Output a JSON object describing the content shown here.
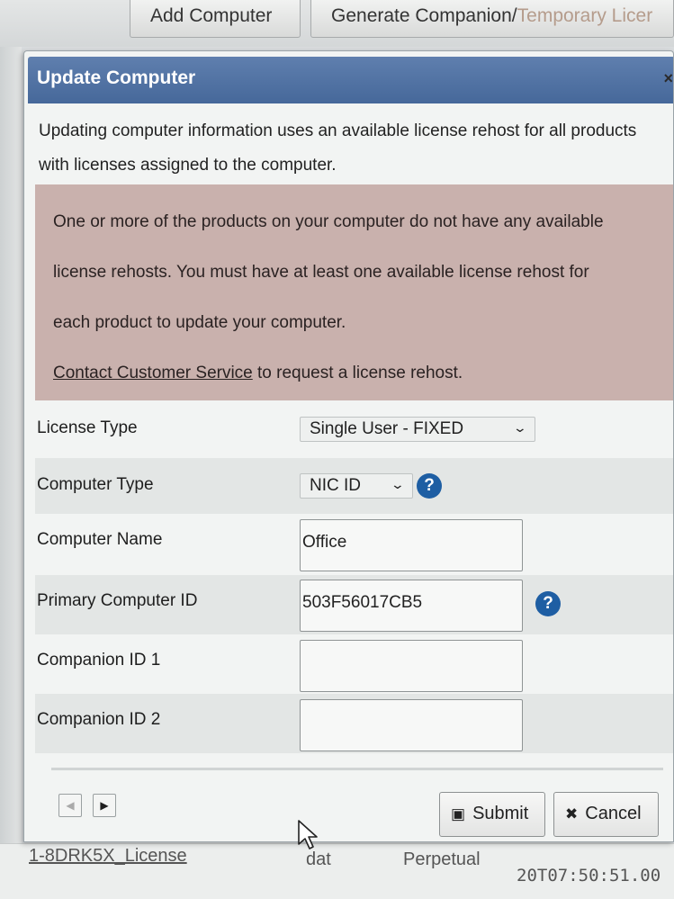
{
  "topbar": {
    "add_computer": "Add Computer",
    "generate_companion_a": "Generate Companion/",
    "generate_companion_b": "Temporary Licer"
  },
  "dialog": {
    "title": "Update Computer",
    "close_glyph": "×",
    "intro": "Updating computer information uses an available license rehost for all products with licenses assigned to the computer.",
    "warning": {
      "line1": "One or more of the products on your computer do not have any available",
      "line2": "license rehosts. You must have at least one available license rehost for",
      "line3": "each product to update your computer.",
      "link": "Contact Customer Service",
      "link_suffix": " to request a license rehost."
    },
    "fields": {
      "license_type": {
        "label": "License Type",
        "value": "Single User - FIXED"
      },
      "computer_type": {
        "label": "Computer Type",
        "value": "NIC ID"
      },
      "computer_name": {
        "label": "Computer Name",
        "value": "Office"
      },
      "primary_id": {
        "label": "Primary Computer ID",
        "value": "503F56017CB5"
      },
      "companion1": {
        "label": "Companion ID 1",
        "value": ""
      },
      "companion2": {
        "label": "Companion ID 2",
        "value": ""
      }
    },
    "help_glyph": "?",
    "buttons": {
      "submit": "Submit",
      "cancel": "Cancel"
    }
  },
  "background_row": {
    "name": "1-8DRK5X_License",
    "col2": "dat",
    "col3": "Perpetual",
    "col4": "20T07:50:51.00"
  },
  "colors": {
    "title_bar": "#4d6f9f",
    "warning_bg": "#c9b1ad",
    "help_icon": "#1e5ea3"
  },
  "icons": {
    "chevron": "chevron-down-icon",
    "help": "question-circle-icon",
    "submit": "floppy-disk-icon",
    "cancel": "x-icon",
    "pager_prev": "triangle-left-icon",
    "pager_next": "triangle-right-icon"
  }
}
